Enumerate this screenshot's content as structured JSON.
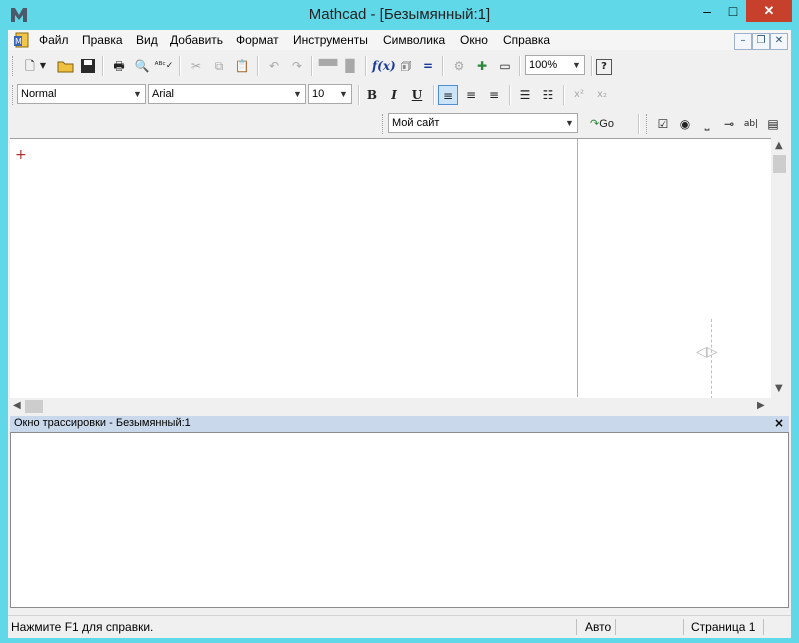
{
  "window": {
    "title": "Mathcad - [Безымянный:1]",
    "minimize": "–",
    "maximize": "□",
    "close": "✕"
  },
  "menu": {
    "items": [
      "Файл",
      "Правка",
      "Вид",
      "Добавить",
      "Формат",
      "Инструменты",
      "Символика",
      "Окно",
      "Справка"
    ],
    "mdi": {
      "minimize": "–",
      "restore": "❐",
      "close": "✕"
    }
  },
  "toolbar_standard": {
    "zoom": "100%",
    "icons": [
      "new-document-icon",
      "open-folder-icon",
      "save-icon",
      "print-icon",
      "print-preview-icon",
      "spell-check-icon",
      "cut-icon",
      "copy-icon",
      "paste-icon",
      "undo-icon",
      "redo-icon",
      "align-top-icon",
      "align-bottom-icon",
      "insert-function-icon",
      "insert-unit-icon",
      "calculate-icon",
      "component-icon",
      "resource-icon",
      "region-icon",
      "help-icon"
    ]
  },
  "toolbar_formatting": {
    "style": "Normal",
    "font": "Arial",
    "size": "10",
    "bold": "B",
    "italic": "I",
    "underline": "U",
    "superscript": "x²",
    "subscript": "x₂"
  },
  "toolbar_web": {
    "location": "Мой сайт",
    "go": "Go"
  },
  "trace": {
    "title": "Окно трассировки - Безымянный:1",
    "close": "×"
  },
  "status": {
    "help": "Нажмите F1 для справки.",
    "mode": "Авто",
    "page": "Страница 1"
  },
  "colors": {
    "titlebar": "#60d8e8",
    "close_button": "#c7402b",
    "trace_header": "#c9d8ea"
  }
}
